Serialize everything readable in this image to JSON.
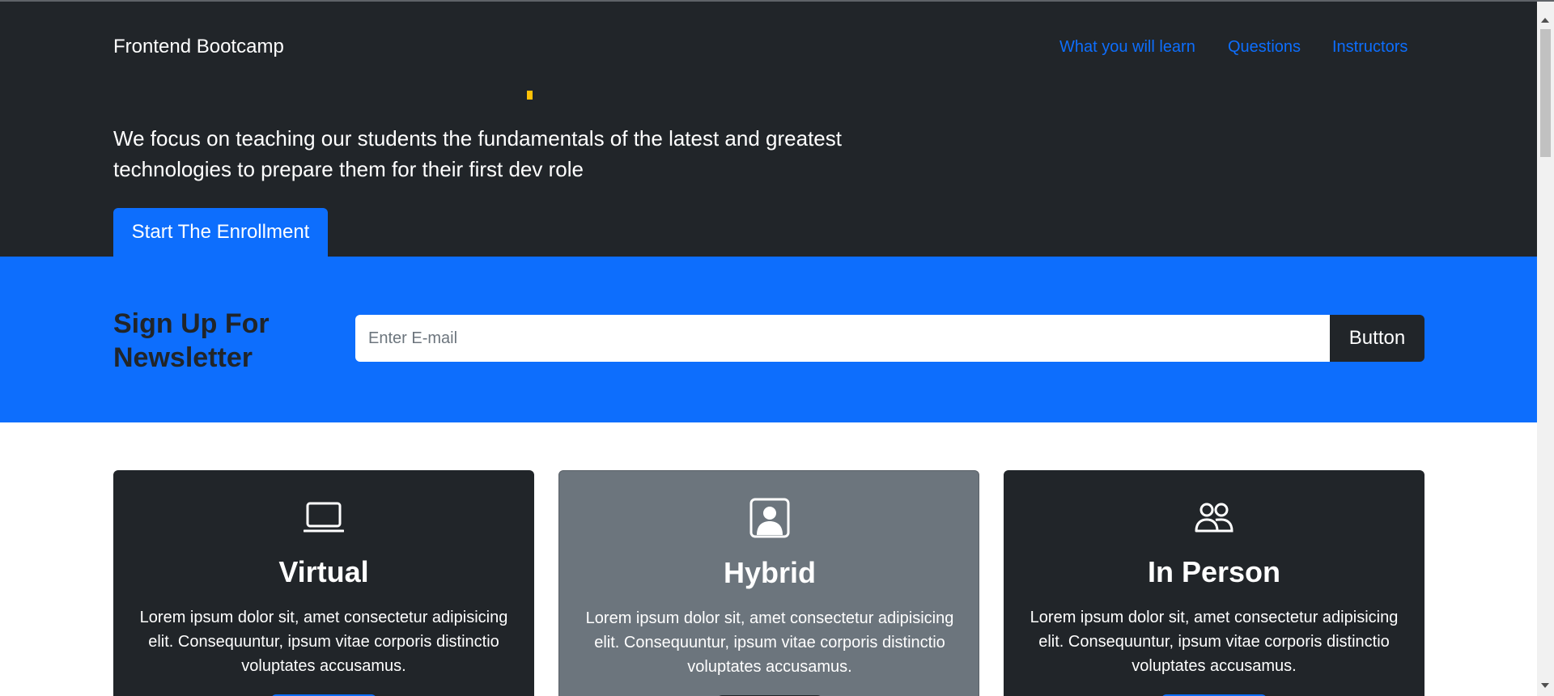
{
  "navbar": {
    "brand": "Frontend Bootcamp",
    "links": [
      "What you will learn",
      "Questions",
      "Instructors"
    ]
  },
  "hero": {
    "lead": "We focus on teaching our students the fundamentals of the latest and greatest technologies to prepare them for their first dev role",
    "cta_label": "Start The Enrollment"
  },
  "newsletter": {
    "title": "Sign Up For Newsletter",
    "input_value": "",
    "input_placeholder": "Enter E-mail",
    "button_label": "Button"
  },
  "cards": [
    {
      "icon": "laptop-icon",
      "title": "Virtual",
      "text": "Lorem ipsum dolor sit, amet consectetur adipisicing elit. Consequuntur, ipsum vitae corporis distinctio voluptates accusamus."
    },
    {
      "icon": "person-square-icon",
      "title": "Hybrid",
      "text": "Lorem ipsum dolor sit, amet consectetur adipisicing elit. Consequuntur, ipsum vitae corporis distinctio voluptates accusamus."
    },
    {
      "icon": "people-icon",
      "title": "In Person",
      "text": "Lorem ipsum dolor sit, amet consectetur adipisicing elit. Consequuntur, ipsum vitae corporis distinctio voluptates accusamus."
    }
  ],
  "colors": {
    "dark": "#212529",
    "primary": "#0d6efd",
    "secondary": "#6c757d",
    "warning": "#ffc107"
  }
}
